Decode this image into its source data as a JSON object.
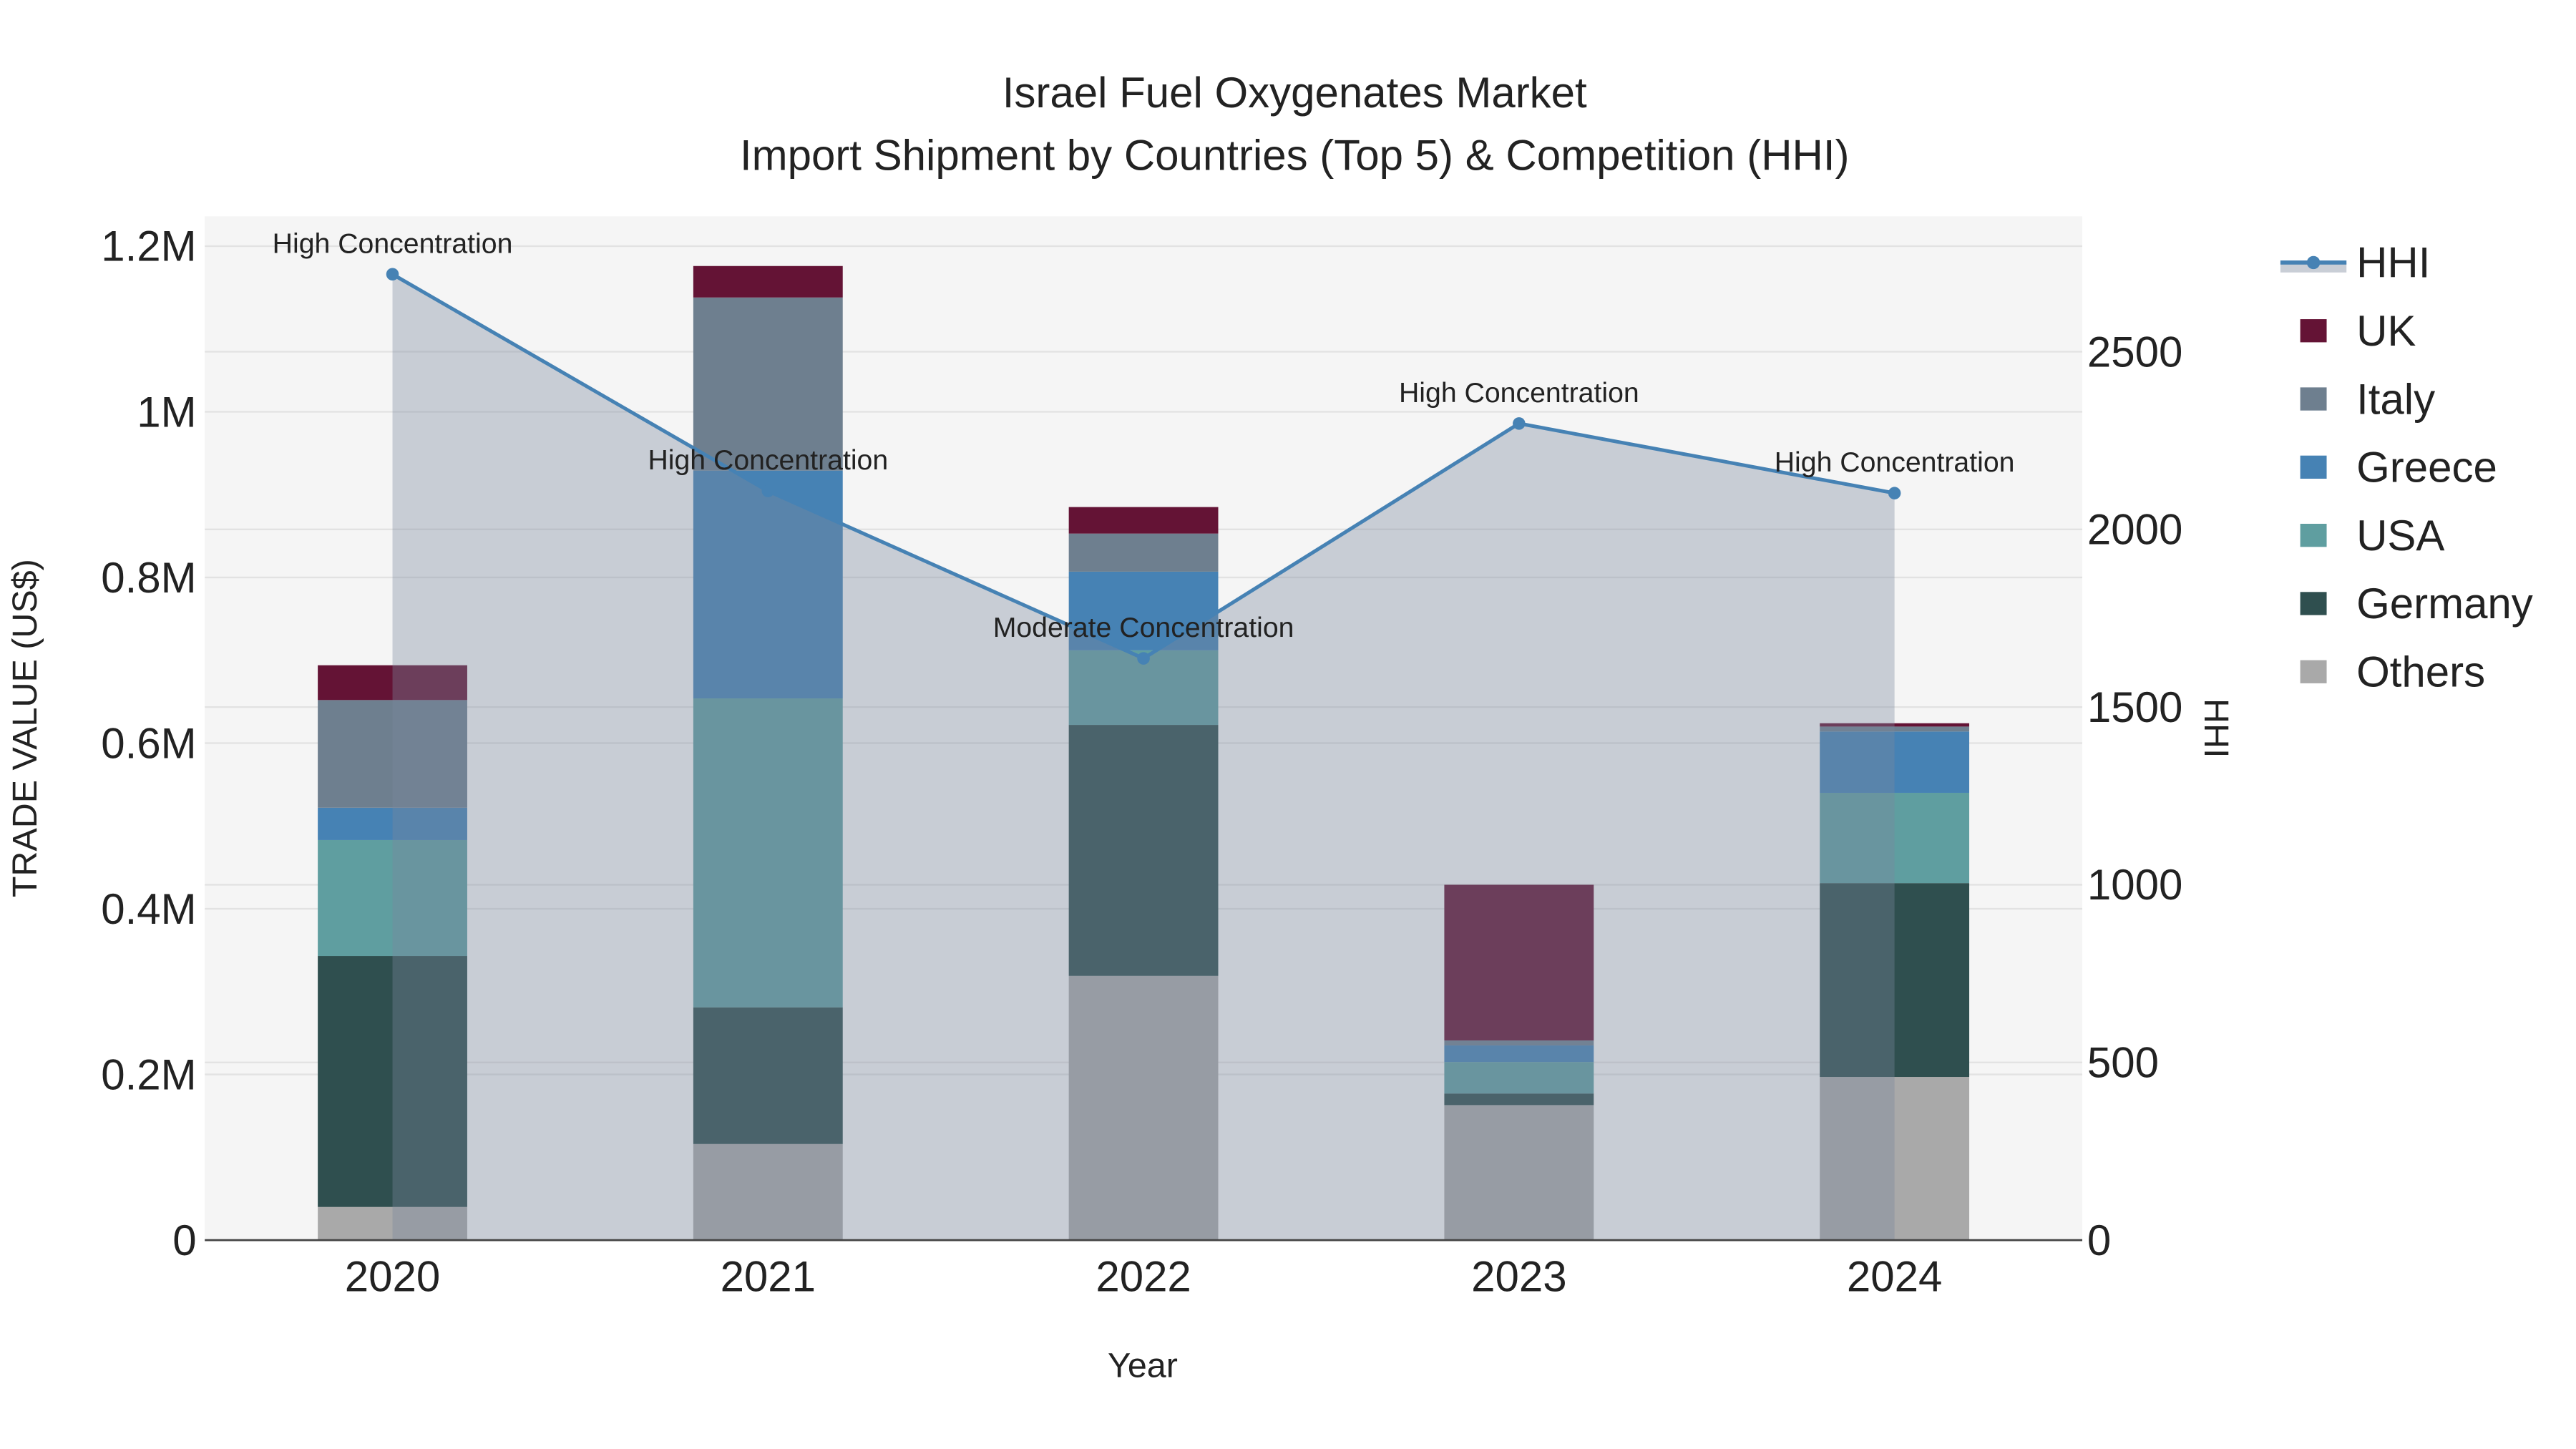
{
  "chart_data": {
    "type": "bar",
    "stacked": true,
    "title": "Israel Fuel Oxygenates Market",
    "subtitle": "Import Shipment by Countries (Top 5) & Competition (HHI)",
    "xlabel": "Year",
    "ylabel": "TRADE VALUE (US$)",
    "y2label": "HHI",
    "categories": [
      "2020",
      "2021",
      "2022",
      "2023",
      "2024"
    ],
    "ylim": [
      0,
      1236000
    ],
    "y2lim": [
      0,
      2881
    ],
    "yticks": [
      {
        "v": 0,
        "label": "0"
      },
      {
        "v": 200000,
        "label": "0.2M"
      },
      {
        "v": 400000,
        "label": "0.4M"
      },
      {
        "v": 600000,
        "label": "0.6M"
      },
      {
        "v": 800000,
        "label": "0.8M"
      },
      {
        "v": 1000000,
        "label": "1M"
      },
      {
        "v": 1200000,
        "label": "1.2M"
      }
    ],
    "y2ticks": [
      {
        "v": 0,
        "label": "0"
      },
      {
        "v": 500,
        "label": "500"
      },
      {
        "v": 1000,
        "label": "1000"
      },
      {
        "v": 1500,
        "label": "1500"
      },
      {
        "v": 2000,
        "label": "2000"
      },
      {
        "v": 2500,
        "label": "2500"
      }
    ],
    "grid": true,
    "legend_position": "right",
    "series": [
      {
        "name": "Others",
        "color": "#a9a9a9",
        "values": [
          40000,
          116000,
          319000,
          163000,
          197000
        ]
      },
      {
        "name": "Germany",
        "color": "#2f4f4f",
        "values": [
          303000,
          165000,
          303000,
          14000,
          234000
        ]
      },
      {
        "name": "USA",
        "color": "#5f9ea0",
        "values": [
          140000,
          373000,
          90000,
          38000,
          109000
        ]
      },
      {
        "name": "Greece",
        "color": "#4682b4",
        "values": [
          39000,
          275000,
          95000,
          20000,
          74000
        ]
      },
      {
        "name": "Italy",
        "color": "#6e7f8f",
        "values": [
          130000,
          209000,
          46000,
          6000,
          6000
        ]
      },
      {
        "name": "UK",
        "color": "#641335",
        "values": [
          42000,
          38000,
          32000,
          188000,
          4000
        ]
      }
    ],
    "hhi": {
      "name": "HHI",
      "color": "#4682b4",
      "values": [
        2718,
        2108,
        1637,
        2298,
        2102
      ],
      "annotations": [
        "High Concentration",
        "High Concentration",
        "Moderate Concentration",
        "High Concentration",
        "High Concentration"
      ]
    },
    "legend_order": [
      "HHI",
      "UK",
      "Italy",
      "Greece",
      "USA",
      "Germany",
      "Others"
    ]
  }
}
